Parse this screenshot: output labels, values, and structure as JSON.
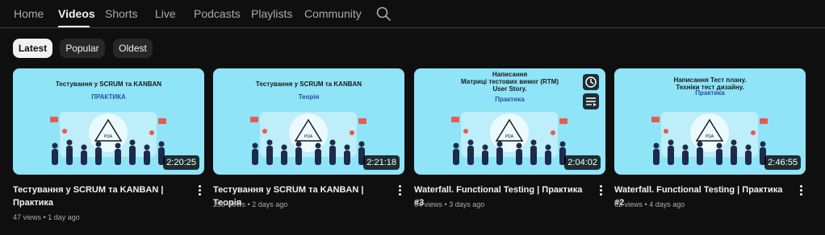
{
  "tabs": [
    {
      "label": "Home",
      "active": false
    },
    {
      "label": "Videos",
      "active": true
    },
    {
      "label": "Shorts",
      "active": false
    },
    {
      "label": "Live",
      "active": false
    },
    {
      "label": "Podcasts",
      "active": false
    },
    {
      "label": "Playlists",
      "active": false
    },
    {
      "label": "Community",
      "active": false
    }
  ],
  "search_icon": "search-icon",
  "filters": [
    {
      "label": "Latest",
      "selected": true
    },
    {
      "label": "Popular",
      "selected": false
    },
    {
      "label": "Oldest",
      "selected": false
    }
  ],
  "videos": [
    {
      "thumb_lines": [
        "Тестування у SCRUM та KANBAN"
      ],
      "thumb_sub": "ПРАКТИКА",
      "duration": "2:20:25",
      "title": "Тестування у SCRUM та KANBAN | Практика",
      "views": "47 views",
      "age": "1 day ago"
    },
    {
      "thumb_lines": [
        "Тестування у SCRUM та KANBAN"
      ],
      "thumb_sub": "Теорія",
      "duration": "2:21:18",
      "title": "Тестування у SCRUM та KANBAN | Теорія",
      "views": "258 views",
      "age": "2 days ago"
    },
    {
      "thumb_lines": [
        "Написання",
        "Матриці тестових вимог (RTM)",
        "User Story."
      ],
      "thumb_sub": "Практика",
      "duration": "2:04:02",
      "title": "Waterfall. Functional Testing | Практика #3",
      "views": "54 views",
      "age": "3 days ago",
      "hover_icons": [
        "clock-icon",
        "add-to-queue-icon"
      ]
    },
    {
      "thumb_lines": [
        "Написання Тест плану.",
        "Техніки тест дизайну."
      ],
      "thumb_sub": "Практика",
      "duration": "2:46:55",
      "title": "Waterfall. Functional Testing | Практика #2",
      "views": "62 views",
      "age": "4 days ago"
    }
  ],
  "meta_separator": "•",
  "colors": {
    "background": "#0f0f0f",
    "thumbnail": "#8fe4f7",
    "chip_selected": "#f1f1f1",
    "chip": "#272727"
  }
}
